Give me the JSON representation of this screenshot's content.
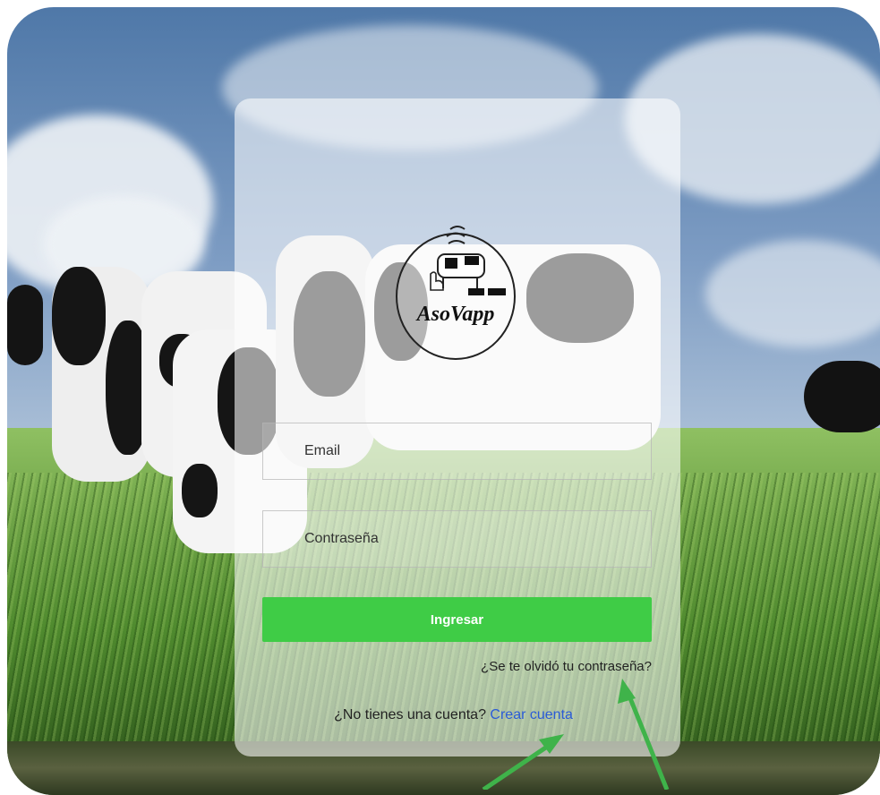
{
  "brand": {
    "logo_text": "AsoVapp"
  },
  "form": {
    "email_placeholder": "Email",
    "password_placeholder": "Contraseña",
    "submit_label": "Ingresar",
    "forgot_label": "¿Se te olvidó tu contraseña?",
    "signup_prompt": "¿No tienes una cuenta?",
    "signup_link": "Crear cuenta"
  },
  "colors": {
    "accent": "#3fcc46",
    "link": "#2a5bd7",
    "annotation_arrow": "#3fb34a"
  },
  "icons": [
    "logo-emblem",
    "annotation-arrow"
  ]
}
